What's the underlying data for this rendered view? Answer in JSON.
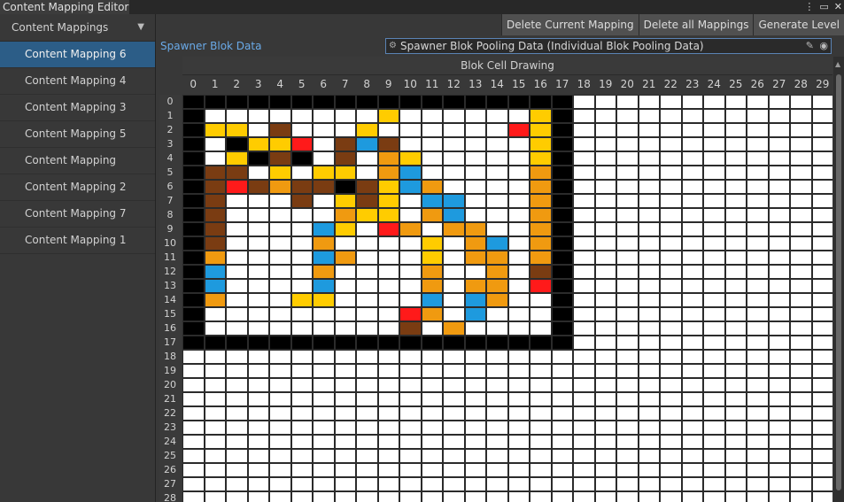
{
  "window": {
    "title": "Content Mapping Editor"
  },
  "sidebar": {
    "header": "Content Mappings",
    "items": [
      {
        "label": "Content Mapping 6",
        "selected": true
      },
      {
        "label": "Content Mapping 4",
        "selected": false
      },
      {
        "label": "Content Mapping 3",
        "selected": false
      },
      {
        "label": "Content Mapping 5",
        "selected": false
      },
      {
        "label": "Content Mapping",
        "selected": false
      },
      {
        "label": "Content Mapping 2",
        "selected": false
      },
      {
        "label": "Content Mapping 7",
        "selected": false
      },
      {
        "label": "Content Mapping 1",
        "selected": false
      }
    ]
  },
  "toolbar": {
    "delete_current": "Delete Current Mapping",
    "delete_all": "Delete all Mappings",
    "generate": "Generate Level"
  },
  "spawner": {
    "label": "Spawner Blok Data",
    "value": "Spawner Blok Pooling Data (Individual Blok Pooling Data)"
  },
  "grid": {
    "caption": "Blok Cell Drawing",
    "columns": 30,
    "rows_visible": 29,
    "palette": {
      "W": "#ffffff",
      "K": "#000000",
      "Y": "#ffcc00",
      "O": "#f09a10",
      "B": "#1e9ade",
      "R": "#ff1a1a",
      "N": "#7a3c12"
    },
    "rows": [
      "KKKKKKKKKKKKKKKKKKWWWWWWWWWWWW",
      "KWWWWWWWWYWWWWWWYKWWWWWWWWWWWW",
      "KYYWNWWWYWWWWWWRYKWWWWWWWWWWWW",
      "KWKYYRWNBNWWWWWWYKWWWWWWWWWWWW",
      "KWYKNKWNWOYWWWWWYKWWWWWWWWWWWW",
      "KNNWYWYYWOBWWWWWOKWWWWWWWWWWWW",
      "KNRNONNKNYBOWWWWOKWWWWWWWWWWWW",
      "KNWWWNWYNYWBBWWWOKWWWWWWWWWWWW",
      "KNWWWWWOYYWOBWWWOKWWWWWWWWWWWW",
      "KNWWWWBYWROWOOWWOKWWWWWWWWWWWW",
      "KNWWWWOWWWWYWOBWOKWWWWWWWWWWWW",
      "KOWWWWBOWWWYWOOWOKWWWWWWWWWWWW",
      "KBWWWWOWWWWOWWOWNKWWWWWWWWWWWW",
      "KBWWWWBWWWWOWOOWRKWWWWWWWWWWWW",
      "KOWWWYYWWWWBWBOWWKWWWWWWWWWWWW",
      "KWWWWWWWWWROWBWWWKWWWWWWWWWWWW",
      "KWWWWWWWWWNWOWWWWKWWWWWWWWWWWW",
      "KKKKKKKKKKKKKKKKKKWWWWWWWWWWWW",
      "WWWWWWWWWWWWWWWWWWWWWWWWWWWWWW",
      "WWWWWWWWWWWWWWWWWWWWWWWWWWWWWW",
      "WWWWWWWWWWWWWWWWWWWWWWWWWWWWWW",
      "WWWWWWWWWWWWWWWWWWWWWWWWWWWWWW",
      "WWWWWWWWWWWWWWWWWWWWWWWWWWWWWW",
      "WWWWWWWWWWWWWWWWWWWWWWWWWWWWWW",
      "WWWWWWWWWWWWWWWWWWWWWWWWWWWWWW",
      "WWWWWWWWWWWWWWWWWWWWWWWWWWWWWW",
      "WWWWWWWWWWWWWWWWWWWWWWWWWWWWWW",
      "WWWWWWWWWWWWWWWWWWWWWWWWWWWWWW",
      "WWWWWWWWWWWWWWWWWWWWWWWWWWWWWW"
    ]
  }
}
